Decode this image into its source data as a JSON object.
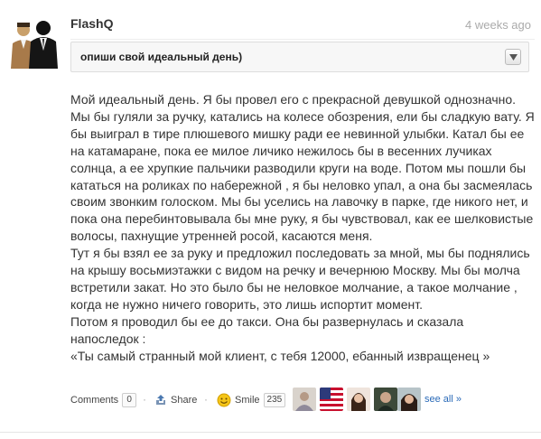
{
  "post": {
    "username": "FlashQ",
    "timestamp": "4 weeks ago",
    "avatar_icon": "two-men-in-suits-avatar",
    "question": "опиши свой идеальный день)",
    "answer_paragraphs": [
      "Мой идеальный день. Я бы провел его с прекрасной девушкой однозначно. Мы бы гуляли за ручку, катались на колесе обозрения, ели бы сладкую вату. Я бы выиграл в тире плюшевого мишку ради ее невинной улыбки. Катал бы ее на катамаране, пока ее милое личико нежилось бы в весенних лучиках солнца, а ее хрупкие пальчики разводили круги на воде. Потом мы пошли бы кататься на роликах по набережной , я бы неловко упал, а она бы засмеялась своим звонким голоском. Мы бы уселись на лавочку в парке, где никого нет, и пока она перебинтовывала бы мне руку, я бы чувствовал, как ее шелковистые волосы, пахнущие утренней росой, касаются меня.",
      "Тут я бы взял ее за руку и предложил последовать за мной, мы бы поднялись на крышу восьмиэтажки с видом на речку и вечернюю Москву. Мы бы молча встретили закат. Но это было бы не неловкое молчание, а такое молчание , когда не нужно ничего говорить, это лишь испортит момент.",
      "Потом я проводил бы ее до такси. Она бы развернулась и сказала напоследок :",
      "«Ты самый странный мой клиент, с тебя 12000, ебанный извращенец »"
    ]
  },
  "footer": {
    "comments_label": "Comments",
    "comments_count": "0",
    "share_label": "Share",
    "smile_label": "Smile",
    "smile_count": "235",
    "see_all_label": "see all »",
    "separator": "·"
  },
  "colors": {
    "link": "#2a6ab8",
    "timestamp": "#aaaaaa",
    "smile_icon": "#f5c518"
  }
}
